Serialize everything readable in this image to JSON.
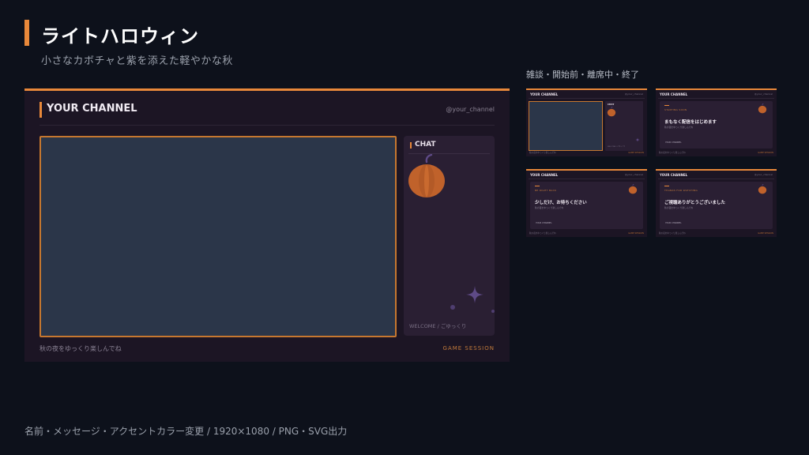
{
  "header": {
    "title": "ライトハロウィン",
    "subtitle": "小さなカボチャと紫を添えた軽やかな秋"
  },
  "thumbnails_label": "雑談・開始前・離席中・終了",
  "preview": {
    "channel_name": "YOUR CHANNEL",
    "handle": "@your_channel",
    "chat_title": "CHAT",
    "chat_welcome": "WELCOME / ごゆっくり",
    "caption": "秋の夜をゆっくり楽しんでね",
    "session_label": "GAME SESSION"
  },
  "thumbnails": [
    {
      "type": "chat",
      "channel_name": "YOUR CHANNEL",
      "handle": "@your_channel",
      "chat_title": "CHAT",
      "chat_welcome": "WELCOME / ごゆっくり",
      "caption": "秋の夜をゆっくり楽しんでね",
      "session_label": "GAME SESSION"
    },
    {
      "type": "message",
      "channel_name": "YOUR CHANNEL",
      "handle": "@your_channel",
      "tag": "STARTING SOON",
      "message": "まもなく配信をはじめます",
      "sub": "秋の夜をゆっくり楽しんでね",
      "logo": "YOUR CHANNEL",
      "caption": "秋の夜をゆっくり楽しんでね",
      "session_label": "GAME SESSION"
    },
    {
      "type": "message",
      "channel_name": "YOUR CHANNEL",
      "handle": "@your_channel",
      "tag": "BE RIGHT BACK",
      "message": "少しだけ、お待ちください",
      "sub": "秋の夜をゆっくり楽しんでね",
      "logo": "YOUR CHANNEL",
      "caption": "秋の夜をゆっくり楽しんでね",
      "session_label": "GAME SESSION"
    },
    {
      "type": "message",
      "channel_name": "YOUR CHANNEL",
      "handle": "@your_channel",
      "tag": "THANKS FOR WATCHING",
      "message": "ご視聴ありがとうございました",
      "sub": "秋の夜をゆっくり楽しんでね",
      "logo": "YOUR CHANNEL",
      "caption": "秋の夜をゆっくり楽しんでね",
      "session_label": "GAME SESSION"
    }
  ],
  "footer": "名前・メッセージ・アクセントカラー変更 / 1920×1080 / PNG・SVG出力",
  "colors": {
    "accent": "#e8883a",
    "background": "#0d111b",
    "panel": "#1c1524",
    "chat_panel": "#2a1f33",
    "video_area": "#2b3649",
    "pumpkin": "#c0622b",
    "sparkle": "#5e4a86"
  },
  "icons": {
    "pumpkin": "pumpkin-icon",
    "sparkle": "sparkle-icon"
  }
}
